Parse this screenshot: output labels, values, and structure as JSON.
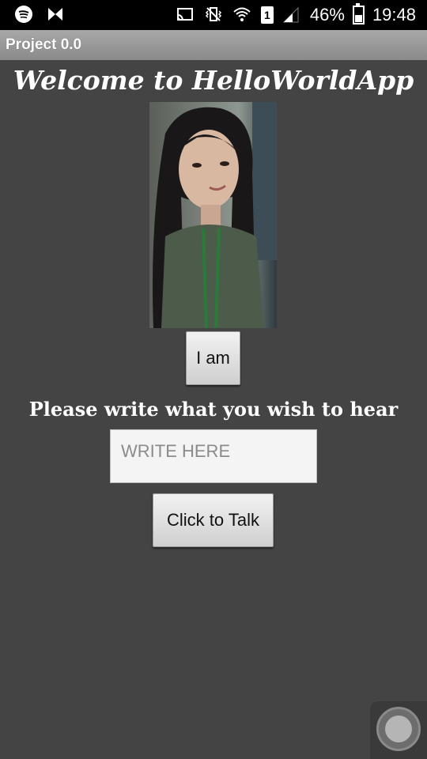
{
  "status_bar": {
    "battery_percent": "46%",
    "battery_level": 0.46,
    "time": "19:48",
    "sim_label": "1",
    "icons": [
      "spotify-icon",
      "notification-icon",
      "cast-icon",
      "vibrate-icon",
      "wifi-icon",
      "sim-icon",
      "signal-icon",
      "battery-icon"
    ]
  },
  "title_bar": {
    "title": "Project 0.0"
  },
  "main": {
    "welcome": "Welcome to HelloWorldApp",
    "photo_icon": "profile-photo",
    "i_am_button": "I am",
    "prompt": "Please write what you wish to hear",
    "input_placeholder": "WRITE HERE",
    "input_value": "",
    "talk_button": "Click to Talk"
  },
  "colors": {
    "background": "#444444",
    "status_bar": "#000000",
    "title_bar": "#9a9a9a",
    "text": "#ffffff"
  }
}
